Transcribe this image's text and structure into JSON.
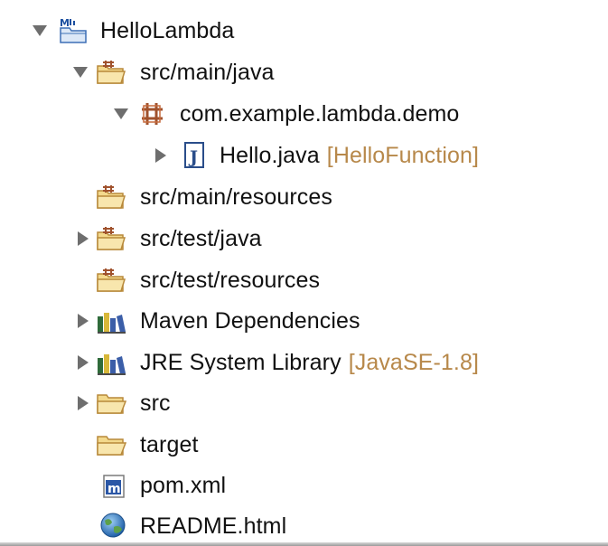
{
  "tree": {
    "project": {
      "label": "HelloLambda",
      "icon": "maven-project-icon"
    },
    "src_main_java": {
      "label": "src/main/java",
      "icon": "source-folder-icon"
    },
    "package": {
      "label": "com.example.lambda.demo",
      "icon": "package-icon"
    },
    "hello_java": {
      "label": "Hello.java",
      "decoration": "[HelloFunction]",
      "icon": "java-file-icon"
    },
    "src_main_resources": {
      "label": "src/main/resources",
      "icon": "source-folder-icon"
    },
    "src_test_java": {
      "label": "src/test/java",
      "icon": "source-folder-icon"
    },
    "src_test_resources": {
      "label": "src/test/resources",
      "icon": "source-folder-icon"
    },
    "maven_deps": {
      "label": "Maven Dependencies",
      "icon": "library-icon"
    },
    "jre": {
      "label": "JRE System Library",
      "decoration": "[JavaSE-1.8]",
      "icon": "library-icon"
    },
    "src": {
      "label": "src",
      "icon": "folder-icon"
    },
    "target": {
      "label": "target",
      "icon": "folder-icon"
    },
    "pom": {
      "label": "pom.xml",
      "icon": "maven-file-icon"
    },
    "readme": {
      "label": "README.html",
      "icon": "globe-icon"
    }
  },
  "colors": {
    "decoration": "#b7884a",
    "folder": "#f3d98c",
    "folder_stroke": "#b8893a",
    "twisty": "#6e6e6e"
  }
}
